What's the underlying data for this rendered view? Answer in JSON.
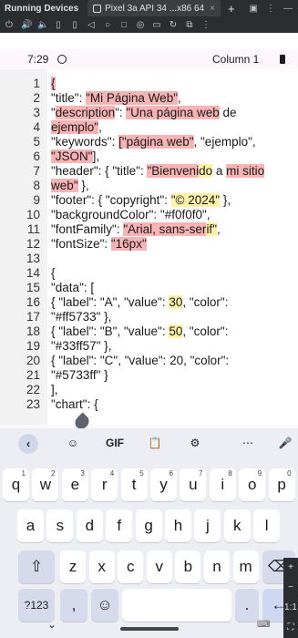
{
  "ide": {
    "title": "Running Devices",
    "tab_label": "Pixel 3a API 34 ...x86 64",
    "tab_close": "×",
    "new_tab": "+",
    "right_icons": [
      "▣",
      "⋮",
      "—"
    ],
    "toolbar_icons": [
      "⏻",
      "🔊",
      "🔈",
      "▯",
      "▯",
      "◁",
      "○",
      "□",
      "◎",
      "▭",
      "↻",
      "⧉",
      "⋮"
    ]
  },
  "status": {
    "time": "7:29",
    "column": "Column 1"
  },
  "editor": {
    "line_numbers": [
      "1",
      "2",
      "3",
      "4",
      "5",
      "6",
      "7",
      "8",
      "9",
      "10",
      "11",
      "12",
      "13",
      "14",
      "15",
      "16",
      "17",
      "18",
      "19",
      "20",
      "21",
      "22",
      "23"
    ],
    "lines": [
      [
        {
          "t": "{",
          "c": "pk"
        }
      ],
      [
        {
          "t": "  \"title\": "
        },
        {
          "t": "\"Mi Página Web\"",
          "c": "pk"
        },
        {
          "t": ","
        }
      ],
      [
        {
          "t": "  \""
        },
        {
          "t": "description",
          "c": "pk"
        },
        {
          "t": "\": "
        },
        {
          "t": "\"Una página web",
          "c": "pk"
        },
        {
          "t": " de"
        }
      ],
      [
        {
          "t": "ejemplo\"",
          "c": "pk"
        },
        {
          "t": ","
        }
      ],
      [
        {
          "t": "  \"keywords\": "
        },
        {
          "t": "[\"página web\"",
          "c": "pk"
        },
        {
          "t": ", \"ejemplo\","
        }
      ],
      [
        {
          "t": "\"JSON\"",
          "c": "pk"
        },
        {
          "t": "],"
        }
      ],
      [
        {
          "t": "  \"header\": { \"title\": "
        },
        {
          "t": "\"Bienveni",
          "c": "pk"
        },
        {
          "t": "do",
          "c": "yl"
        },
        {
          "t": " a "
        },
        {
          "t": "mi sitio",
          "c": "pk"
        }
      ],
      [
        {
          "t": "web\"",
          "c": "pk"
        },
        {
          "t": " },"
        }
      ],
      [
        {
          "t": "  \"footer\": { \"copyright\": "
        },
        {
          "t": "\"© 2024\"",
          "c": "yl"
        },
        {
          "t": " },"
        }
      ],
      [
        {
          "t": "  \"backgroundColor\": \"#f0f0f0\","
        }
      ],
      [
        {
          "t": "  \"fontFamily\": "
        },
        {
          "t": "\"Arial, sans-ser",
          "c": "pk"
        },
        {
          "t": "if\"",
          "c": "yl"
        },
        {
          "t": ","
        }
      ],
      [
        {
          "t": "  \"fontSize\": "
        },
        {
          "t": "\"16px\"",
          "c": "pk"
        }
      ],
      [
        {
          "t": ""
        }
      ],
      [
        {
          "t": "  {"
        }
      ],
      [
        {
          "t": "    \"data\": ["
        }
      ],
      [
        {
          "t": "      { \"label\": \"A\", \"value\": "
        },
        {
          "t": "30",
          "c": "yl"
        },
        {
          "t": ", \"color\":"
        }
      ],
      [
        {
          "t": "\"#ff5733\" },"
        }
      ],
      [
        {
          "t": "      { \"label\": \"B\", \"value\": "
        },
        {
          "t": "50",
          "c": "yl"
        },
        {
          "t": ", \"color\":"
        }
      ],
      [
        {
          "t": "\"#33ff57\" },"
        }
      ],
      [
        {
          "t": "    { \"label\": \"C\", \"value\": 20, \"color\":"
        }
      ],
      [
        {
          "t": "\"#5733ff\" }"
        }
      ],
      [
        {
          "t": "  ],"
        }
      ],
      [
        {
          "t": "    \"chart\": {"
        }
      ]
    ]
  },
  "keyboard": {
    "suggestions": [
      "☺",
      "GIF",
      "📋",
      "⚙",
      "⋯",
      "🎤"
    ],
    "back_label": "‹",
    "row1": [
      {
        "k": "q",
        "n": "1"
      },
      {
        "k": "w",
        "n": "2"
      },
      {
        "k": "e",
        "n": "3"
      },
      {
        "k": "r",
        "n": "4"
      },
      {
        "k": "t",
        "n": "5"
      },
      {
        "k": "y",
        "n": "6"
      },
      {
        "k": "u",
        "n": "7"
      },
      {
        "k": "i",
        "n": "8"
      },
      {
        "k": "o",
        "n": "9"
      },
      {
        "k": "p",
        "n": "0"
      }
    ],
    "row2": [
      "a",
      "s",
      "d",
      "f",
      "g",
      "h",
      "j",
      "k",
      "l"
    ],
    "row3": [
      "z",
      "x",
      "c",
      "v",
      "b",
      "n",
      "m"
    ],
    "shift_label": "⇧",
    "backspace_label": "⌫",
    "symbols_label": "?123",
    "comma_label": ",",
    "emoji_label": "☺",
    "space_label": "",
    "period_label": ".",
    "enter_label": "←",
    "nav_chevron": "⌄",
    "nav_keyboard": "⌨"
  },
  "side_controls": [
    "+",
    "−",
    "1:1",
    "⛶"
  ],
  "colors": {
    "ide_bg": "#2b2d30",
    "highlight_pink": "#f8b4b4",
    "highlight_yellow": "#fff1a8",
    "keyboard_bg": "#edeef3",
    "enter_key": "#cfd8f3"
  }
}
